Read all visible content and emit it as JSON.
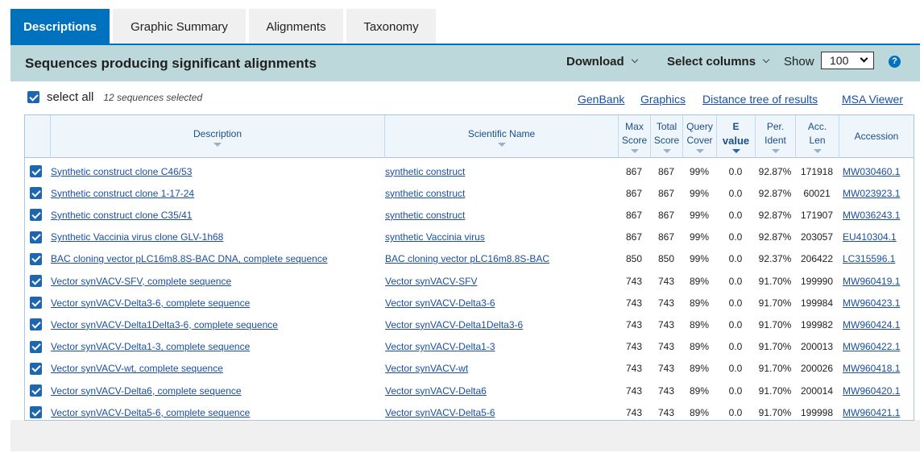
{
  "tabs": [
    {
      "label": "Descriptions",
      "active": true
    },
    {
      "label": "Graphic Summary",
      "active": false
    },
    {
      "label": "Alignments",
      "active": false
    },
    {
      "label": "Taxonomy",
      "active": false
    }
  ],
  "header": {
    "title": "Sequences producing significant alignments",
    "download_label": "Download",
    "select_columns_label": "Select columns",
    "show_label": "Show",
    "show_value": "100",
    "help_glyph": "?"
  },
  "selection": {
    "select_all_label": "select all",
    "selected_count": "12 sequences selected",
    "links": [
      "GenBank",
      "Graphics",
      "Distance tree of results",
      "MSA Viewer"
    ]
  },
  "table": {
    "columns": {
      "description": "Description",
      "scientific_name": "Scientific Name",
      "max_score": [
        "Max",
        "Score"
      ],
      "total_score": [
        "Total",
        "Score"
      ],
      "query_cover": [
        "Query",
        "Cover"
      ],
      "e_value": [
        "E",
        "value"
      ],
      "per_ident": [
        "Per.",
        "Ident"
      ],
      "acc_len": [
        "Acc.",
        "Len"
      ],
      "accession": "Accession"
    },
    "rows": [
      {
        "description": "Synthetic construct clone C46/53",
        "scientific_name": "synthetic construct",
        "max_score": "867",
        "total_score": "867",
        "query_cover": "99%",
        "e_value": "0.0",
        "per_ident": "92.87%",
        "acc_len": "171918",
        "accession": "MW030460.1"
      },
      {
        "description": "Synthetic construct clone 1-17-24",
        "scientific_name": "synthetic construct",
        "max_score": "867",
        "total_score": "867",
        "query_cover": "99%",
        "e_value": "0.0",
        "per_ident": "92.87%",
        "acc_len": "60021",
        "accession": "MW023923.1"
      },
      {
        "description": "Synthetic construct clone C35/41",
        "scientific_name": "synthetic construct",
        "max_score": "867",
        "total_score": "867",
        "query_cover": "99%",
        "e_value": "0.0",
        "per_ident": "92.87%",
        "acc_len": "171907",
        "accession": "MW036243.1"
      },
      {
        "description": "Synthetic Vaccinia virus clone GLV-1h68",
        "scientific_name": "synthetic Vaccinia virus",
        "max_score": "867",
        "total_score": "867",
        "query_cover": "99%",
        "e_value": "0.0",
        "per_ident": "92.87%",
        "acc_len": "203057",
        "accession": "EU410304.1"
      },
      {
        "description": "BAC cloning vector pLC16m8.8S-BAC DNA, complete sequence",
        "scientific_name": "BAC cloning vector pLC16m8.8S-BAC",
        "max_score": "850",
        "total_score": "850",
        "query_cover": "99%",
        "e_value": "0.0",
        "per_ident": "92.37%",
        "acc_len": "206422",
        "accession": "LC315596.1"
      },
      {
        "description": "Vector synVACV-SFV, complete sequence",
        "scientific_name": "Vector synVACV-SFV",
        "max_score": "743",
        "total_score": "743",
        "query_cover": "89%",
        "e_value": "0.0",
        "per_ident": "91.70%",
        "acc_len": "199990",
        "accession": "MW960419.1"
      },
      {
        "description": "Vector synVACV-Delta3-6, complete sequence",
        "scientific_name": "Vector synVACV-Delta3-6",
        "max_score": "743",
        "total_score": "743",
        "query_cover": "89%",
        "e_value": "0.0",
        "per_ident": "91.70%",
        "acc_len": "199984",
        "accession": "MW960423.1"
      },
      {
        "description": "Vector synVACV-Delta1Delta3-6, complete sequence",
        "scientific_name": "Vector synVACV-Delta1Delta3-6",
        "max_score": "743",
        "total_score": "743",
        "query_cover": "89%",
        "e_value": "0.0",
        "per_ident": "91.70%",
        "acc_len": "199982",
        "accession": "MW960424.1"
      },
      {
        "description": "Vector synVACV-Delta1-3, complete sequence",
        "scientific_name": "Vector synVACV-Delta1-3",
        "max_score": "743",
        "total_score": "743",
        "query_cover": "89%",
        "e_value": "0.0",
        "per_ident": "91.70%",
        "acc_len": "200013",
        "accession": "MW960422.1"
      },
      {
        "description": "Vector synVACV-wt, complete sequence",
        "scientific_name": "Vector synVACV-wt",
        "max_score": "743",
        "total_score": "743",
        "query_cover": "89%",
        "e_value": "0.0",
        "per_ident": "91.70%",
        "acc_len": "200026",
        "accession": "MW960418.1"
      },
      {
        "description": "Vector synVACV-Delta6, complete sequence",
        "scientific_name": "Vector synVACV-Delta6",
        "max_score": "743",
        "total_score": "743",
        "query_cover": "89%",
        "e_value": "0.0",
        "per_ident": "91.70%",
        "acc_len": "200014",
        "accession": "MW960420.1"
      },
      {
        "description": "Vector synVACV-Delta5-6, complete sequence",
        "scientific_name": "Vector synVACV-Delta5-6",
        "max_score": "743",
        "total_score": "743",
        "query_cover": "89%",
        "e_value": "0.0",
        "per_ident": "91.70%",
        "acc_len": "199998",
        "accession": "MW960421.1"
      }
    ]
  },
  "colors": {
    "tab_active": "#0071bc",
    "header_band": "#bdd8da",
    "link": "#1a4fa0",
    "checkbox": "#1d66b1"
  }
}
